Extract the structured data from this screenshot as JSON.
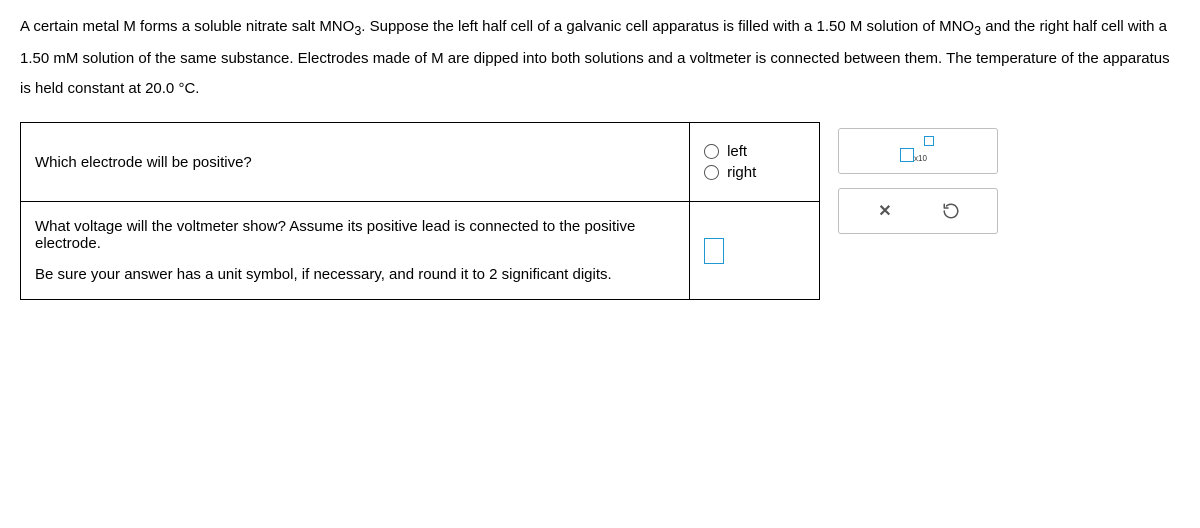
{
  "problem": {
    "line1_a": "A certain metal ",
    "M": "M",
    "line1_b": " forms a soluble nitrate salt ",
    "MNO3": "MNO",
    "sub3": "3",
    "line1_c": ". Suppose the left half cell of a galvanic cell apparatus is filled with a ",
    "conc1": "1.50 M",
    "line1_d": " solution of ",
    "line1_e": " and the right half cell with a ",
    "conc2": "1.50 mM",
    "line1_f": " solution of the same substance. Electrodes made of ",
    "line1_g": " are dipped into both solutions and a voltmeter is connected between them. The temperature of the apparatus is held constant at ",
    "temp": "20.0 °C",
    "line1_h": "."
  },
  "q1": {
    "prompt": "Which electrode will be positive?",
    "opt_left": "left",
    "opt_right": "right"
  },
  "q2": {
    "prompt_a": "What voltage will the voltmeter show? Assume its positive lead is connected to the positive electrode.",
    "prompt_b": "Be sure your answer has a unit symbol, if necessary, and round it to ",
    "sig": "2",
    "prompt_c": " significant digits."
  },
  "side": {
    "x10": "x10"
  }
}
